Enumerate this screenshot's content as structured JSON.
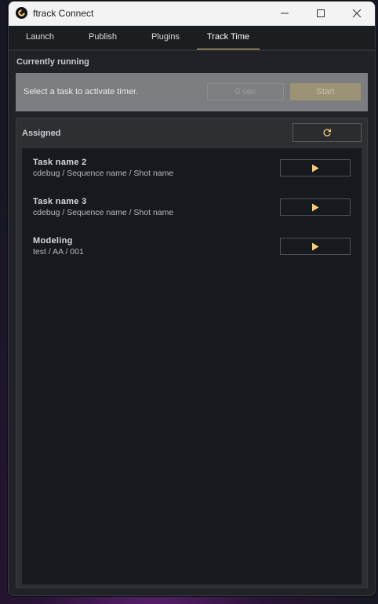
{
  "window": {
    "title": "ftrack Connect",
    "controls": {
      "minimize": "minimize-icon",
      "maximize": "maximize-icon",
      "close": "close-icon"
    }
  },
  "tabs": [
    {
      "label": "Launch",
      "active": false
    },
    {
      "label": "Publish",
      "active": false
    },
    {
      "label": "Plugins",
      "active": false
    },
    {
      "label": "Track Time",
      "active": true
    }
  ],
  "running": {
    "heading": "Currently running",
    "message": "Select a task to activate timer.",
    "timer": "0 sec",
    "start_label": "Start"
  },
  "assigned": {
    "heading": "Assigned",
    "refresh_icon": "refresh-icon",
    "tasks": [
      {
        "name": "Task name 2",
        "path": "cdebug / Sequence name / Shot name"
      },
      {
        "name": "Task name 3",
        "path": "cdebug / Sequence name / Shot name"
      },
      {
        "name": "Modeling",
        "path": "test / AA / 001"
      }
    ]
  },
  "colors": {
    "accent": "#f4d07a",
    "play_icon": "#f4d07a",
    "window_bg": "#202227",
    "task_list_bg": "#161a1f"
  }
}
